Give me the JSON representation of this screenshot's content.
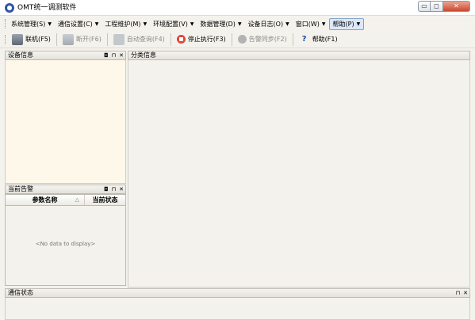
{
  "window": {
    "title": "OMT统一调测软件",
    "minimize_symbol": "▭",
    "restore_symbol": "◻",
    "close_symbol": "✕"
  },
  "menu": {
    "items": [
      {
        "label": "系统管理(S)"
      },
      {
        "label": "通信设置(C)"
      },
      {
        "label": "工程维护(M)"
      },
      {
        "label": "环境配置(V)"
      },
      {
        "label": "数据管理(D)"
      },
      {
        "label": "设备日志(O)"
      },
      {
        "label": "窗口(W)"
      },
      {
        "label": "帮助(P)"
      }
    ],
    "arrow": "▼"
  },
  "toolbar": {
    "connect": "联机(F5)",
    "disconnect": "断开(F6)",
    "auto_query": "自动查询(F4)",
    "stop": "停止执行(F3)",
    "alarm_sync": "告警同步(F2)",
    "help": "帮助(F1)",
    "help_glyph": "?"
  },
  "panels": {
    "device_info": "设备信息",
    "class_info": "分类信息",
    "current_alarm": "当前告警",
    "comm_status": "通信状态",
    "ctrl_float": "◘",
    "ctrl_pin": "⊓",
    "ctrl_close": "✕"
  },
  "alarm_table": {
    "columns": [
      "参数名称",
      "当前状态"
    ],
    "sort_indicator": "△",
    "empty_text": "<No data to display>"
  }
}
